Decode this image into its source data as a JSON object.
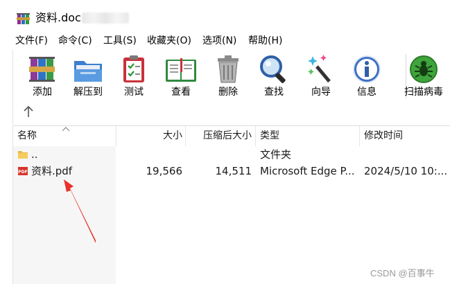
{
  "window": {
    "title": "资料.doc",
    "icon": "winrar-archive-icon"
  },
  "menu": [
    {
      "label": "文件(F)"
    },
    {
      "label": "命令(C)"
    },
    {
      "label": "工具(S)"
    },
    {
      "label": "收藏夹(O)"
    },
    {
      "label": "选项(N)"
    },
    {
      "label": "帮助(H)"
    }
  ],
  "toolbar": [
    {
      "label": "添加",
      "icon": "add-books-icon"
    },
    {
      "label": "解压到",
      "icon": "extract-folder-icon"
    },
    {
      "label": "测试",
      "icon": "test-clipboard-icon"
    },
    {
      "label": "查看",
      "icon": "view-book-icon"
    },
    {
      "label": "删除",
      "icon": "trash-icon"
    },
    {
      "label": "查找",
      "icon": "magnifier-icon"
    },
    {
      "label": "向导",
      "icon": "magic-wand-icon"
    },
    {
      "label": "信息",
      "icon": "info-icon"
    },
    {
      "label": "扫描病毒",
      "icon": "virus-scan-icon"
    }
  ],
  "nav": {
    "up_icon": "up-arrow-icon"
  },
  "columns": {
    "name": "名称",
    "size": "大小",
    "packed": "压缩后大小",
    "type": "类型",
    "modified": "修改时间"
  },
  "files": [
    {
      "name": "..",
      "size": "",
      "packed": "",
      "type": "文件夹",
      "modified": "",
      "icon": "folder-icon"
    },
    {
      "name": "资料.pdf",
      "size": "19,566",
      "packed": "14,511",
      "type": "Microsoft Edge P...",
      "modified": "2024/5/10 10:...",
      "icon": "pdf-icon"
    }
  ],
  "annotation": {
    "color": "#e8322b"
  },
  "watermark": "CSDN @百事牛"
}
